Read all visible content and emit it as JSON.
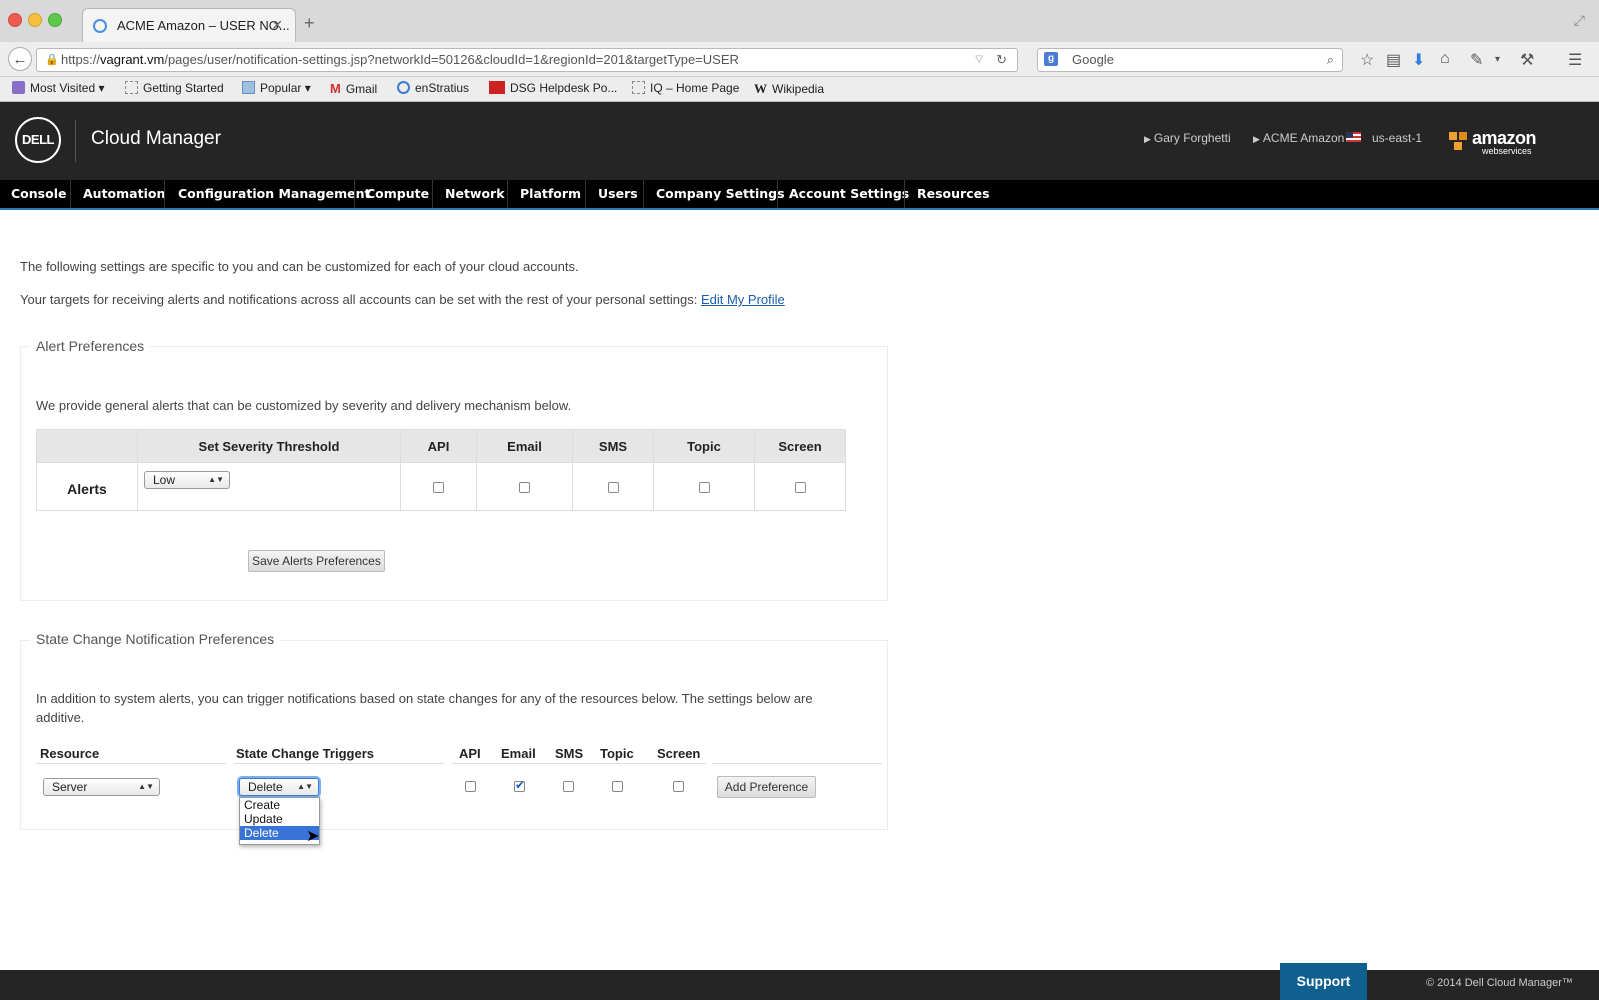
{
  "browser": {
    "tab_title": "ACME Amazon – USER NO...",
    "url_host": "vagrant.vm",
    "url_prefix": "https://",
    "url_path": "/pages/user/notification-settings.jsp?networkId=50126&cloudId=1&regionId=201&targetType=USER",
    "search_placeholder": "Google",
    "bookmarks": [
      "Most Visited",
      "Getting Started",
      "Popular",
      "Gmail",
      "enStratius",
      "DSG Helpdesk Po...",
      "IQ – Home Page",
      "Wikipedia"
    ]
  },
  "header": {
    "logo_text": "DELL",
    "app_title": "Cloud Manager",
    "user": "Gary Forghetti",
    "account": "ACME Amazon",
    "region": "us-east-1",
    "aws_logo": "amazon",
    "aws_sub": "webservices"
  },
  "nav": [
    "Console",
    "Automation",
    "Configuration Management",
    "Compute",
    "Network",
    "Platform",
    "Users",
    "Company Settings",
    "Account Settings",
    "Resources"
  ],
  "intro": {
    "line1": "The following settings are specific to you and can be customized for each of your cloud accounts.",
    "line2": "Your targets for receiving alerts and notifications across all accounts can be set with the rest of your personal settings:",
    "link": "Edit My Profile"
  },
  "alerts": {
    "legend": "Alert Preferences",
    "description": "We provide general alerts that can be customized by severity and delivery mechanism below.",
    "headers": [
      "Set Severity Threshold",
      "API",
      "Email",
      "SMS",
      "Topic",
      "Screen"
    ],
    "row_label": "Alerts",
    "severity": "Low",
    "save_button": "Save Alerts Preferences"
  },
  "state_change": {
    "legend": "State Change Notification Preferences",
    "description_line1": "In addition to system alerts, you can trigger notifications based on state changes for any of the resources below. The settings below are",
    "description_line2": "additive.",
    "headers": [
      "Resource",
      "State Change Triggers",
      "API",
      "Email",
      "SMS",
      "Topic",
      "Screen"
    ],
    "resource": "Server",
    "trigger": "Delete",
    "trigger_options": [
      "Create",
      "Update",
      "Delete"
    ],
    "add_button": "Add Preference"
  },
  "footer": {
    "support": "Support",
    "copyright": "© 2014 Dell Cloud Manager™"
  },
  "colors": {
    "header_bg": "#252525",
    "nav_bg": "#000000",
    "link": "#1a5fa8",
    "support_bg": "#10608f",
    "selected_option": "#3874d8"
  }
}
